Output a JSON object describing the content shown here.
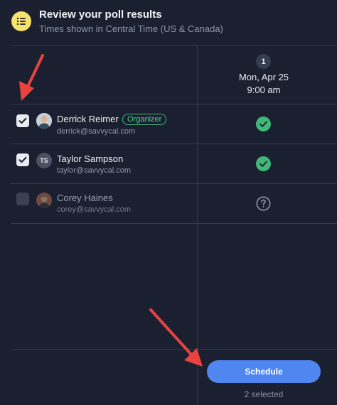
{
  "header": {
    "icon": "list-icon",
    "title": "Review your poll results",
    "subtitle": "Times shown in Central Time (US & Canada)"
  },
  "time_slot": {
    "number": "1",
    "date": "Mon, Apr 25",
    "time": "9:00 am"
  },
  "participants": [
    {
      "name": "Derrick Reimer",
      "email": "derrick@savvycal.com",
      "badge": "Organizer",
      "checked": true,
      "status": "available"
    },
    {
      "name": "Taylor Sampson",
      "email": "taylor@savvycal.com",
      "initials": "TS",
      "checked": true,
      "status": "available"
    },
    {
      "name": "Corey Haines",
      "email": "corey@savvycal.com",
      "checked": false,
      "status": "unknown"
    }
  ],
  "footer": {
    "schedule_label": "Schedule",
    "selected_text": "2 selected"
  },
  "colors": {
    "background": "#1b2030",
    "accent": "#4f86f0",
    "available": "#3fb87a",
    "poll_icon": "#f5e36b",
    "annotation_arrow": "#e8433f"
  }
}
